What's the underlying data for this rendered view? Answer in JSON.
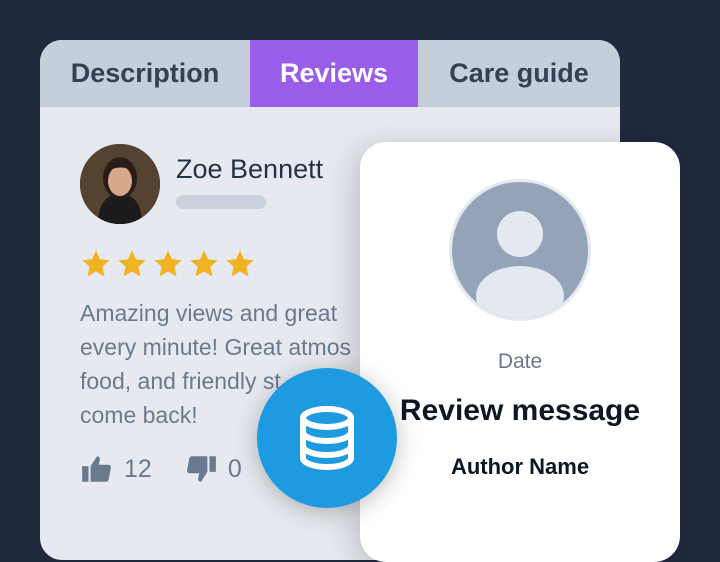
{
  "tabs": [
    {
      "label": "Description"
    },
    {
      "label": "Reviews",
      "active": true
    },
    {
      "label": "Care guide"
    }
  ],
  "review": {
    "author": "Zoe Bennett",
    "rating": 5,
    "max_rating": 5,
    "text": "Amazing views and great\nevery minute! Great atmos\nfood, and friendly st\ncome back!",
    "likes": "12",
    "dislikes": "0"
  },
  "template_card": {
    "date_label": "Date",
    "message_label": "Review message",
    "author_label": "Author Name"
  },
  "icons": {
    "like": "thumbs-up-icon",
    "dislike": "thumbs-down-icon",
    "star": "star-icon",
    "placeholder": "user-placeholder-icon",
    "badge": "database-icon"
  },
  "colors": {
    "background": "#1f2a3d",
    "active_tab": "#9a5de8",
    "star": "#f0b323",
    "badge": "#1e9ae0"
  }
}
